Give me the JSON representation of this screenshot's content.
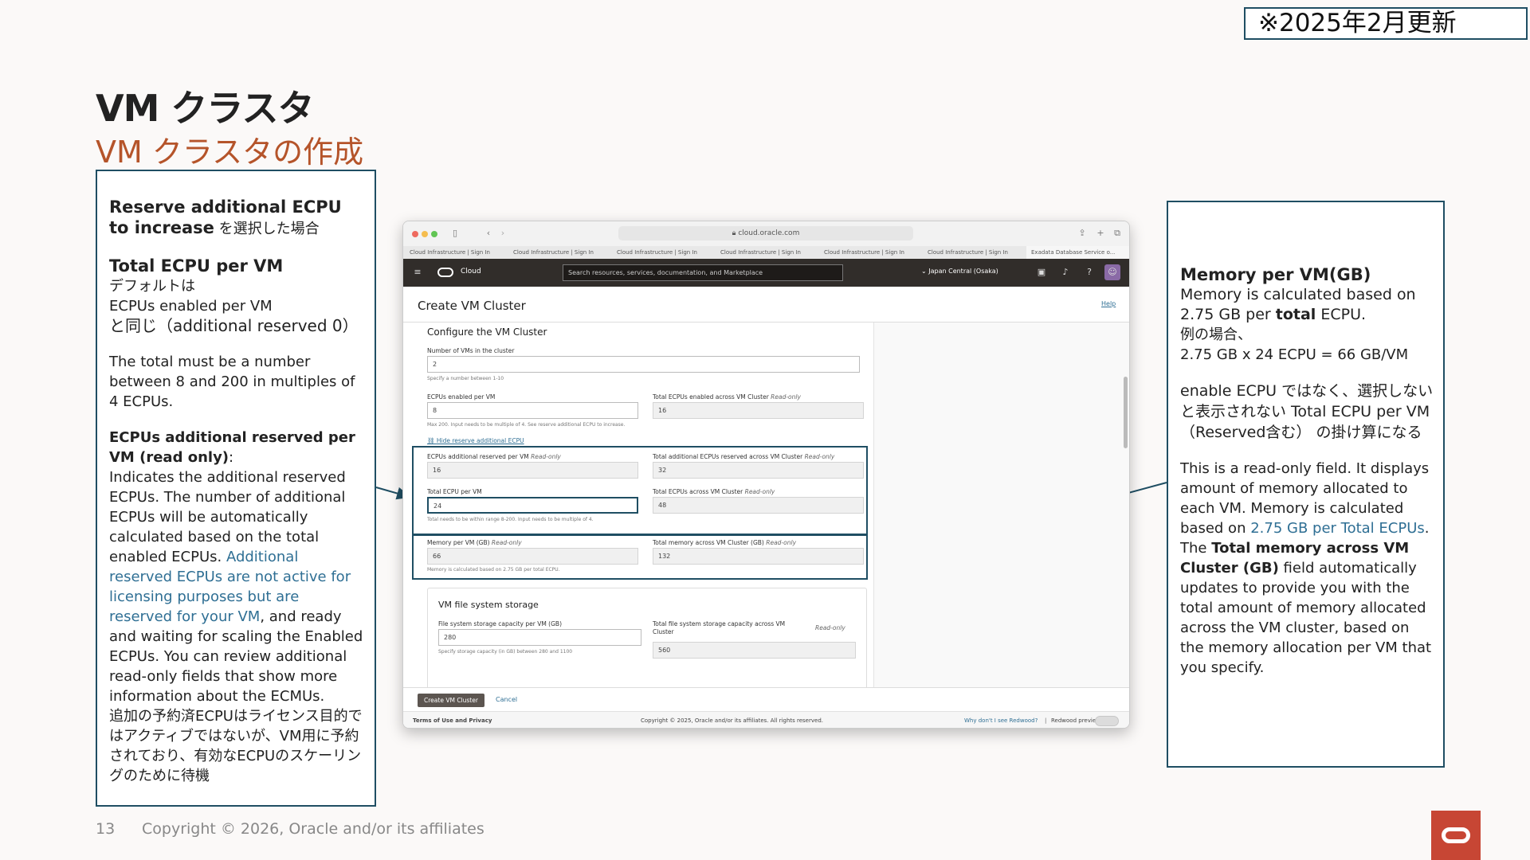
{
  "badge": "※2025年2月更新",
  "title": "VM クラスタ",
  "subtitle": "VM クラスタの作成",
  "left": {
    "h1_bold": "Reserve additional ECPU to increase",
    "h1_rest": " を選択した場合",
    "h2": "Total ECPU per VM",
    "default_1": "デフォルトは",
    "default_2": "ECPUs enabled per VM",
    "default_3": "と同じ（additional reserved 0）",
    "total_must": "The total must be a number between 8 and 200 in multiples of 4 ECPUs.",
    "h3": "ECPUs additional reserved per VM (read only)",
    "colon": ":",
    "desc_1": "Indicates the additional reserved ECPUs. The number of additional ECPUs will be automatically calculated based on the total enabled ECPUs. ",
    "desc_link": "Additional reserved ECPUs are not active for licensing purposes but are reserved for your VM",
    "desc_2": ", and ready and waiting for scaling the Enabled ECPUs. You can review additional read-only fields that show more information about the ECMUs.",
    "jp_note": "追加の予約済ECPUはライセンス目的ではアクティブではないが、VM用に予約されており、有効なECPUのスケーリングのために待機"
  },
  "right": {
    "h1": "Memory per VM(GB)",
    "p1_a": "Memory is calculated based on 2.75 GB per ",
    "p1_b": "total",
    "p1_c": " ECPU.",
    "ex_1": "例の場合、",
    "ex_2": "2.75 GB x 24 ECPU = 66 GB/VM",
    "jp_2": "enable ECPU ではなく、選択しないと表示されない Total ECPU per VM （Reserved含む） の掛け算になる",
    "p3_a": "This is a read-only field. It displays amount of memory allocated to each VM. Memory is calculated based on ",
    "p3_link": "2.75 GB per Total ECPUs",
    "p3_b": ". The ",
    "p3_bold": "Total memory across VM Cluster (GB)",
    "p3_c": " field automatically updates to provide you with the total amount of memory allocated across the VM cluster, based on the memory allocation per VM that you specify."
  },
  "footer": {
    "page": "13",
    "copyright": "Copyright © 2026, Oracle and/or its affiliates"
  },
  "shot": {
    "url": "cloud.oracle.com",
    "tabs": [
      "Cloud Infrastructure | Sign In",
      "Cloud Infrastructure | Sign In",
      "Cloud Infrastructure | Sign In",
      "Cloud Infrastructure | Sign In",
      "Cloud Infrastructure | Sign In",
      "Cloud Infrastructure | Sign In",
      "Exadata Database Service o..."
    ],
    "brand": "Cloud",
    "search_placeholder": "Search resources, services, documentation, and Marketplace",
    "region": "Japan Central (Osaka)",
    "page_title": "Create VM Cluster",
    "help": "Help",
    "section": "Configure the VM Cluster",
    "num_vms_label": "Number of VMs in the cluster",
    "num_vms": "2",
    "num_vms_hint": "Specify a number between 1-10",
    "ecpus_enabled_label": "ECPUs enabled per VM",
    "ecpus_enabled": "8",
    "ecpus_enabled_hint": "Max 200. Input needs to be multiple of 4. See reserve additional ECPU to increase.",
    "total_ecpus_enabled_label": "Total ECPUs enabled across VM Cluster",
    "total_ecpus_enabled": "16",
    "read_only": "Read-only",
    "hide_link": "Hide reserve additional ECPU",
    "add_reserved_label": "ECPUs additional reserved per VM",
    "add_reserved": "16",
    "total_add_reserved_label": "Total additional ECPUs reserved across VM Cluster",
    "total_add_reserved": "32",
    "total_ecpu_vm_label": "Total ECPU per VM",
    "total_ecpu_vm": "24",
    "total_ecpu_vm_hint": "Total needs to be within range 8-200. Input needs to be multiple of 4.",
    "total_ecpus_cluster_label": "Total ECPUs across VM Cluster",
    "total_ecpus_cluster": "48",
    "mem_vm_label": "Memory per VM (GB)",
    "mem_vm": "66",
    "mem_hint": "Memory is calculated based on 2.75 GB per total ECPU.",
    "total_mem_label": "Total memory across VM Cluster (GB)",
    "total_mem": "132",
    "fs_section": "VM file system storage",
    "fs_label": "File system storage capacity per VM (GB)",
    "fs_value": "280",
    "fs_hint": "Specify storage capacity (in GB) between 280 and 1100",
    "total_fs_label": "Total file system storage capacity across VM Cluster",
    "total_fs": "560",
    "create_btn": "Create VM Cluster",
    "cancel": "Cancel",
    "terms": "Terms of Use and Privacy",
    "oci_copyright": "Copyright © 2025, Oracle and/or its affiliates. All rights reserved.",
    "redwood_q": "Why don't I see Redwood?",
    "redwood_preview": "Redwood preview"
  }
}
